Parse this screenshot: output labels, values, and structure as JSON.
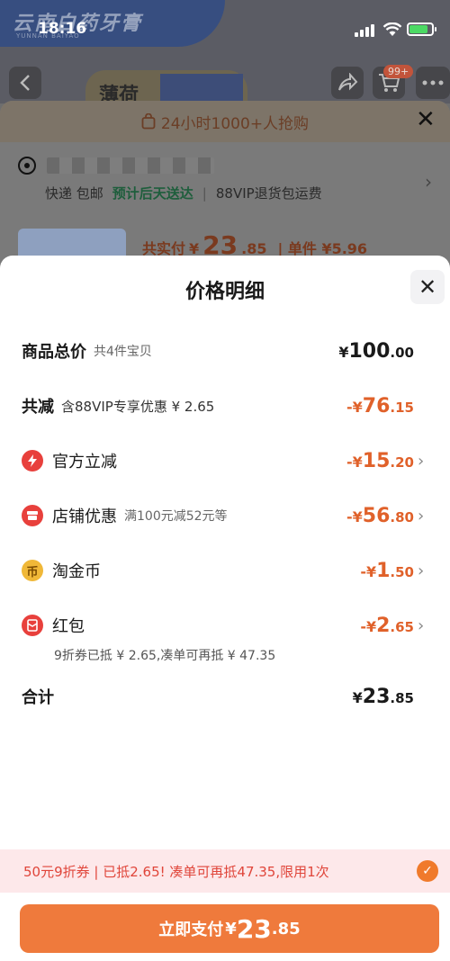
{
  "status_bar": {
    "time": "18:16"
  },
  "background": {
    "banner_text": "云南白药牙膏",
    "banner_sub": "YUNNAN BAIYAO",
    "product_text": "薄荷",
    "cart_badge": "99+",
    "flash_sale": "24小时1000+人抢购",
    "shipping": {
      "method": "快递 包邮",
      "eta": "预计后天送达",
      "vip": "88VIP退货包运费"
    },
    "total_label": "共实付",
    "total_currency": "¥",
    "total_int": "23",
    "total_dec": ".85",
    "unit_price": "| 单件 ¥5.96"
  },
  "modal": {
    "title": "价格明细",
    "rows": [
      {
        "label": "商品总价",
        "sub": "共4件宝贝",
        "currency": "¥",
        "int": "100",
        "dec": ".00"
      },
      {
        "label": "共减",
        "sub": "含88VIP专享优惠 ¥ 2.65",
        "currency": "-¥",
        "int": "76",
        "dec": ".15"
      },
      {
        "label": "官方立减",
        "icon": "lightning-icon",
        "currency": "-¥",
        "int": "15",
        "dec": ".20"
      },
      {
        "label": "店铺优惠",
        "sub": "满100元减52元等",
        "icon": "shop-icon",
        "currency": "-¥",
        "int": "56",
        "dec": ".80"
      },
      {
        "label": "淘金币",
        "icon": "coin-icon",
        "currency": "-¥",
        "int": "1",
        "dec": ".50"
      },
      {
        "label": "红包",
        "icon": "red-packet-icon",
        "currency": "-¥",
        "int": "2",
        "dec": ".65"
      },
      {
        "label": "合计",
        "currency": "¥",
        "int": "23",
        "dec": ".85"
      }
    ],
    "red_packet_note": "9折券已抵 ¥ 2.65,凑单可再抵 ¥ 47.35"
  },
  "coupon_bar": {
    "text": "50元9折券 | 已抵2.65! 凑单可再抵47.35,限用1次"
  },
  "pay_button": {
    "label": "立即支付",
    "currency": "¥",
    "int": "23",
    "dec": ".85"
  },
  "colors": {
    "accent": "#ef7a3c",
    "discount": "#e0612a",
    "coupon_bg": "#fde8ea",
    "coupon_text": "#e0453a"
  }
}
